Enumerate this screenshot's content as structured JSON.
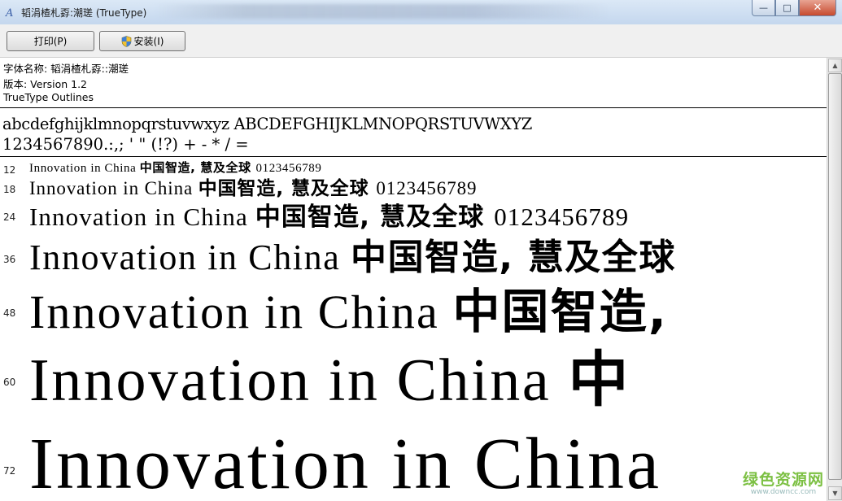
{
  "window": {
    "title": "韬涓楂札孬:潮瑳 (TrueType)",
    "controls": {
      "minimize": "—",
      "maximize": "□",
      "close": "✕"
    }
  },
  "toolbar": {
    "print_label": "打印(P)",
    "install_label": "安装(I)"
  },
  "font_info": {
    "name_line": "字体名称: 韬涓楂札孬::潮瑳",
    "version_line": "版本: Version 1.2",
    "outline_line": "TrueType Outlines"
  },
  "charset": {
    "letters": "abcdefghijklmnopqrstuvwxyz ABCDEFGHIJKLMNOPQRSTUVWXYZ",
    "symbols": "1234567890.:,; ' \" (!?) + - * / ="
  },
  "samples": [
    {
      "size": "12",
      "text": "Innovation in China",
      "cjk": "中国智造, 慧及全球",
      "digits": "0123456789"
    },
    {
      "size": "18",
      "text": "Innovation in China",
      "cjk": "中国智造, 慧及全球",
      "digits": "0123456789"
    },
    {
      "size": "24",
      "text": "Innovation in China",
      "cjk": "中国智造, 慧及全球",
      "digits": "0123456789"
    },
    {
      "size": "36",
      "text": "Innovation in China",
      "cjk": "中国智造, 慧及全球",
      "digits": ""
    },
    {
      "size": "48",
      "text": "Innovation in China",
      "cjk": "中国智造,",
      "digits": ""
    },
    {
      "size": "60",
      "text": "Innovation in China",
      "cjk": "中",
      "digits": ""
    },
    {
      "size": "72",
      "text": "Innovation in China",
      "cjk": "",
      "digits": ""
    }
  ],
  "watermark": {
    "main": "绿色资源网",
    "sub": "www.downcc.com"
  },
  "colors": {
    "titlebar": "#c4d7ee",
    "toolbar": "#f0f0f0",
    "content": "#ffffff",
    "close": "#c74a2e"
  }
}
